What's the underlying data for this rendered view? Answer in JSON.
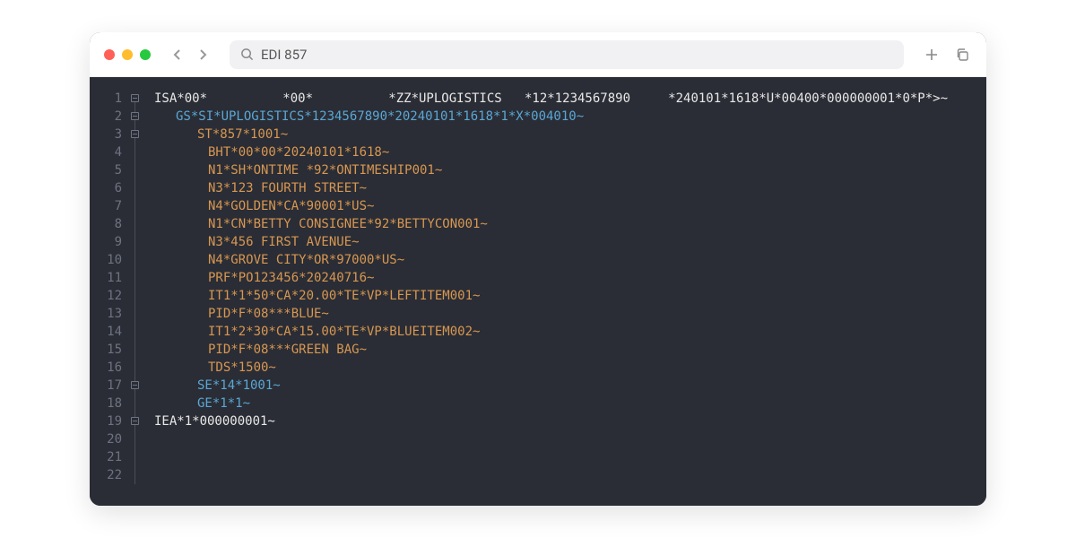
{
  "search": {
    "value": "EDI 857"
  },
  "code": {
    "lines": [
      {
        "n": 1,
        "indent": 0,
        "color": "white",
        "text": "ISA*00*          *00*          *ZZ*UPLOGISTICS   *12*1234567890     *240101*1618*U*00400*000000001*0*P*>~",
        "fold": true
      },
      {
        "n": 2,
        "indent": 1,
        "color": "blue",
        "text": "GS*SI*UPLOGISTICS*1234567890*20240101*1618*1*X*004010~",
        "fold": true
      },
      {
        "n": 3,
        "indent": 2,
        "color": "orange",
        "text": "ST*857*1001~",
        "fold": true
      },
      {
        "n": 4,
        "indent": 3,
        "color": "orange",
        "text": "BHT*00*00*20240101*1618~"
      },
      {
        "n": 5,
        "indent": 3,
        "color": "orange",
        "text": "N1*SH*ONTIME *92*ONTIMESHIP001~"
      },
      {
        "n": 6,
        "indent": 3,
        "color": "orange",
        "text": "N3*123 FOURTH STREET~"
      },
      {
        "n": 7,
        "indent": 3,
        "color": "orange",
        "text": "N4*GOLDEN*CA*90001*US~"
      },
      {
        "n": 8,
        "indent": 3,
        "color": "orange",
        "text": "N1*CN*BETTY CONSIGNEE*92*BETTYCON001~"
      },
      {
        "n": 9,
        "indent": 3,
        "color": "orange",
        "text": "N3*456 FIRST AVENUE~"
      },
      {
        "n": 10,
        "indent": 3,
        "color": "orange",
        "text": "N4*GROVE CITY*OR*97000*US~"
      },
      {
        "n": 11,
        "indent": 3,
        "color": "orange",
        "text": "PRF*PO123456*20240716~"
      },
      {
        "n": 12,
        "indent": 3,
        "color": "orange",
        "text": "IT1*1*50*CA*20.00*TE*VP*LEFTITEM001~"
      },
      {
        "n": 13,
        "indent": 3,
        "color": "orange",
        "text": "PID*F*08***BLUE~"
      },
      {
        "n": 14,
        "indent": 3,
        "color": "orange",
        "text": "IT1*2*30*CA*15.00*TE*VP*BLUEITEM002~"
      },
      {
        "n": 15,
        "indent": 3,
        "color": "orange",
        "text": "PID*F*08***GREEN BAG~"
      },
      {
        "n": 16,
        "indent": 3,
        "color": "orange",
        "text": "TDS*1500~"
      },
      {
        "n": 17,
        "indent": 2,
        "color": "blue",
        "text": "SE*14*1001~",
        "fold": true
      },
      {
        "n": 18,
        "indent": 2,
        "color": "blue",
        "text": "GE*1*1~"
      },
      {
        "n": 19,
        "indent": 0,
        "color": "white",
        "text": "IEA*1*000000001~",
        "fold": true
      },
      {
        "n": 20,
        "indent": 0,
        "color": "white",
        "text": ""
      },
      {
        "n": 21,
        "indent": 0,
        "color": "white",
        "text": ""
      },
      {
        "n": 22,
        "indent": 0,
        "color": "white",
        "text": ""
      }
    ]
  }
}
